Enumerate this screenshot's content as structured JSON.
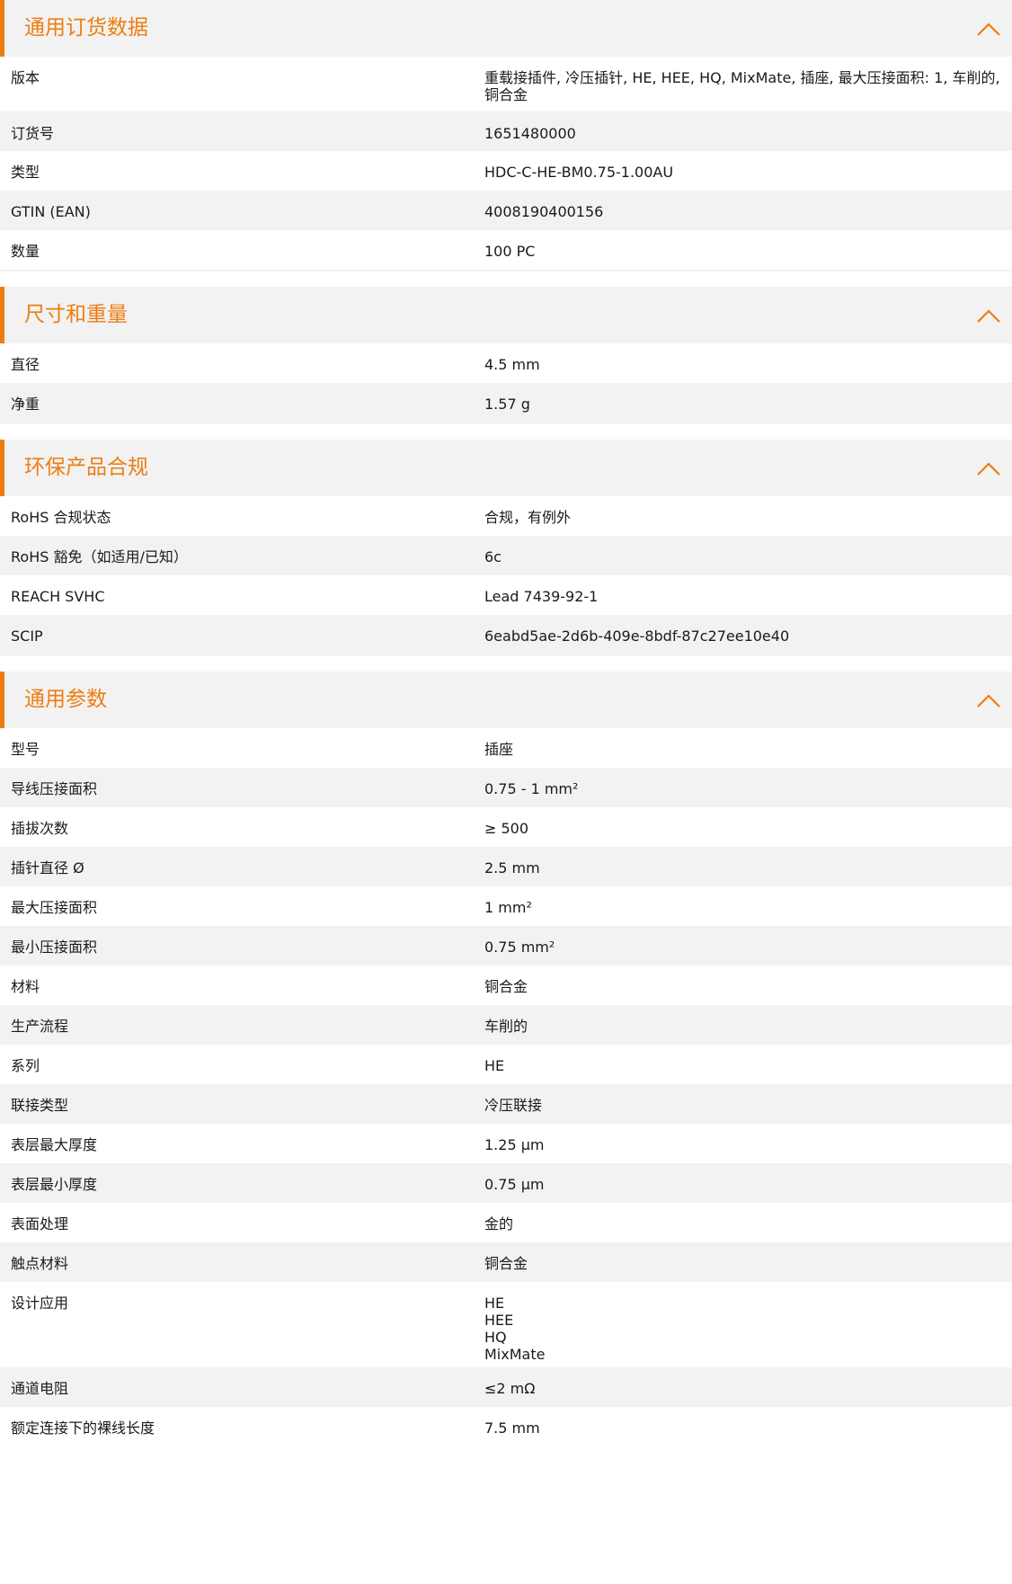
{
  "accent_color": "#ee7d11",
  "icons": {
    "collapse": "chevron-up-icon"
  },
  "sections": [
    {
      "title": "通用订货数据",
      "rows": [
        {
          "label": "版本",
          "value": "重载接插件, 冷压插针, HE, HEE, HQ, MixMate, 插座, 最大压接面积: 1, 车削的, 铜合金"
        },
        {
          "label": "订货号",
          "value": "1651480000"
        },
        {
          "label": "类型",
          "value": "HDC-C-HE-BM0.75-1.00AU"
        },
        {
          "label": "GTIN (EAN)",
          "value": "4008190400156"
        },
        {
          "label": "数量",
          "value": "100  PC"
        }
      ]
    },
    {
      "title": "尺寸和重量",
      "rows": [
        {
          "label": "直径",
          "value": "4.5  mm"
        },
        {
          "label": "净重",
          "value": "1.57  g"
        }
      ]
    },
    {
      "title": "环保产品合规",
      "rows": [
        {
          "label": "RoHS 合规状态",
          "value": "合规，有例外"
        },
        {
          "label": "RoHS 豁免（如适用/已知）",
          "value": "6c"
        },
        {
          "label": "REACH SVHC",
          "value": "Lead 7439-92-1"
        },
        {
          "label": "SCIP",
          "value": "6eabd5ae-2d6b-409e-8bdf-87c27ee10e40"
        }
      ]
    },
    {
      "title": "通用参数",
      "rows": [
        {
          "label": "型号",
          "value": "插座"
        },
        {
          "label": "导线压接面积",
          "value": "0.75 - 1 mm²"
        },
        {
          "label": "插拔次数",
          "value": "≥ 500"
        },
        {
          "label": "插针直径 Ø",
          "value": "2.5  mm"
        },
        {
          "label": "最大压接面积",
          "value": "1  mm²"
        },
        {
          "label": "最小压接面积",
          "value": "0.75  mm²"
        },
        {
          "label": "材料",
          "value": "铜合金"
        },
        {
          "label": "生产流程",
          "value": "车削的"
        },
        {
          "label": "系列",
          "value": "HE"
        },
        {
          "label": "联接类型",
          "value": "冷压联接"
        },
        {
          "label": "表层最大厚度",
          "value": "1.25  µm"
        },
        {
          "label": "表层最小厚度",
          "value": "0.75  µm"
        },
        {
          "label": "表面处理",
          "value": "金的"
        },
        {
          "label": "触点材料",
          "value": "铜合金"
        },
        {
          "label": "设计应用",
          "value": "HE\nHEE\nHQ\nMixMate"
        },
        {
          "label": "通道电阻",
          "value": "≤2 mΩ"
        },
        {
          "label": "额定连接下的裸线长度",
          "value": "7.5  mm"
        }
      ]
    }
  ]
}
